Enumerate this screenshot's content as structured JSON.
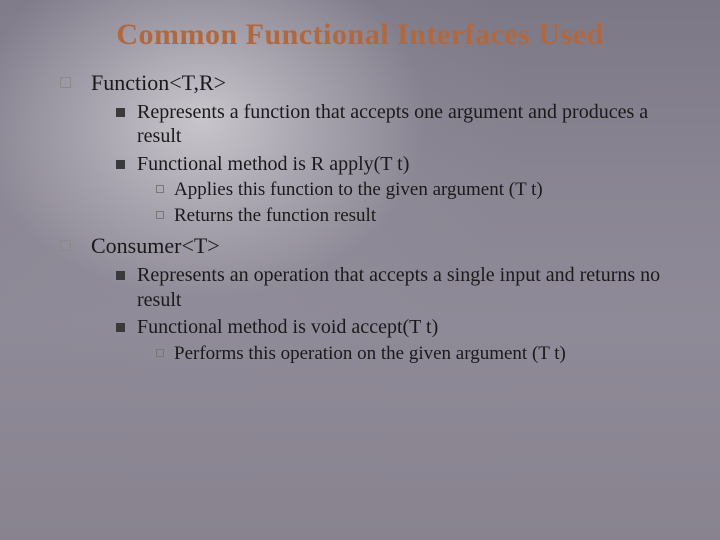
{
  "title": "Common Functional Interfaces Used",
  "items": [
    {
      "label": "Function<T,R>",
      "sub": [
        {
          "label": "Represents a function that accepts one argument and produces a result",
          "sub": []
        },
        {
          "label": "Functional method is R apply(T t)",
          "sub": [
            {
              "label": "Applies this function  to the given argument (T t)"
            },
            {
              "label": "Returns the function result"
            }
          ]
        }
      ]
    },
    {
      "label": "Consumer<T>",
      "sub": [
        {
          "label": "Represents an operation that accepts a single input and returns no result",
          "sub": []
        },
        {
          "label": "Functional method is void accept(T t)",
          "sub": [
            {
              "label": "Performs this operation on the given argument (T t)"
            }
          ]
        }
      ]
    }
  ]
}
